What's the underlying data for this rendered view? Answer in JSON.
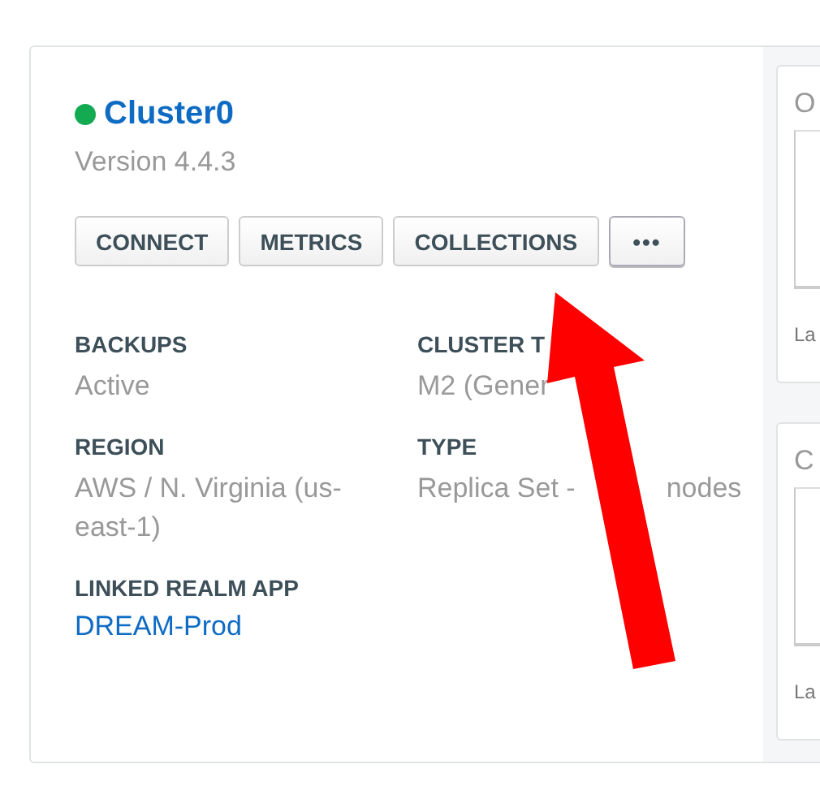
{
  "cluster": {
    "name": "Cluster0",
    "online": true,
    "version": "Version 4.4.3"
  },
  "buttons": [
    {
      "label": "CONNECT",
      "kind": "text"
    },
    {
      "label": "METRICS",
      "kind": "text"
    },
    {
      "label": "COLLECTIONS",
      "kind": "text"
    },
    {
      "label": "•••",
      "kind": "more"
    }
  ],
  "details": [
    {
      "label": "BACKUPS",
      "values": [
        "Active"
      ],
      "kind": "text"
    },
    {
      "label": "CLUSTER T",
      "values": [
        "M2 (Gener"
      ],
      "kind": "text"
    },
    {
      "label": "REGION",
      "values": [
        "AWS / N. Virginia (us-east-1)"
      ],
      "kind": "text"
    },
    {
      "label": "TYPE",
      "values": [
        "Replica Set -",
        "nodes"
      ],
      "kind": "text"
    },
    {
      "label": "LINKED REALM APP",
      "values": [
        "DREAM-Prod"
      ],
      "kind": "link"
    }
  ],
  "side_cards": [
    {
      "title": "O",
      "footer": "La"
    },
    {
      "title": "C",
      "footer": "La"
    }
  ]
}
